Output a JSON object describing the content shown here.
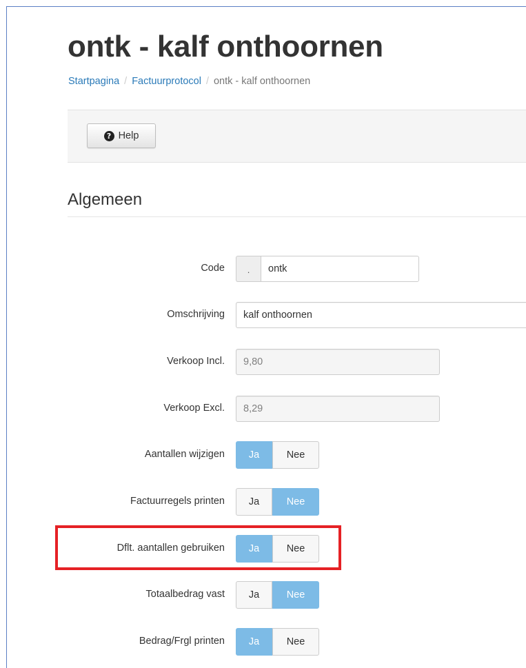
{
  "page": {
    "title": "ontk - kalf onthoornen"
  },
  "breadcrumb": {
    "items": [
      "Startpagina",
      "Factuurprotocol"
    ],
    "separator": "/",
    "current": "ontk - kalf onthoornen"
  },
  "toolbar": {
    "help_label": "Help",
    "help_icon": "question-circle-icon"
  },
  "section": {
    "title": "Algemeen"
  },
  "form": {
    "code": {
      "label": "Code",
      "prefix": ".",
      "value": "ontk"
    },
    "omschrijving": {
      "label": "Omschrijving",
      "value": "kalf onthoornen"
    },
    "verkoop_incl": {
      "label": "Verkoop Incl.",
      "value": "9,80"
    },
    "verkoop_excl": {
      "label": "Verkoop Excl.",
      "value": "8,29"
    },
    "toggles": [
      {
        "label": "Aantallen wijzigen",
        "yes": "Ja",
        "no": "Nee",
        "selected": "Ja"
      },
      {
        "label": "Factuurregels printen",
        "yes": "Ja",
        "no": "Nee",
        "selected": "Nee"
      },
      {
        "label": "Dflt. aantallen gebruiken",
        "yes": "Ja",
        "no": "Nee",
        "selected": "Ja",
        "highlighted": true
      },
      {
        "label": "Totaalbedrag vast",
        "yes": "Ja",
        "no": "Nee",
        "selected": "Nee"
      },
      {
        "label": "Bedrag/Frgl printen",
        "yes": "Ja",
        "no": "Nee",
        "selected": "Ja"
      }
    ]
  },
  "colors": {
    "link": "#2a7ab8",
    "toggle_active": "#7dbbe6",
    "highlight": "#e52125",
    "frame_border": "#5b7fc4"
  }
}
